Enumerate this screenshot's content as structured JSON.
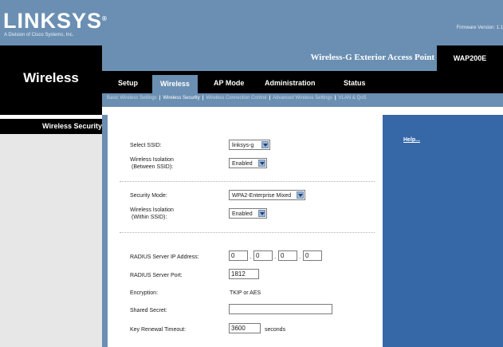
{
  "brand": {
    "logo": "LINKSYS",
    "registered": "®",
    "tagline": "A Division of Cisco Systems, Inc.",
    "firmware": "Firmware Version: 1.1"
  },
  "header": {
    "section_title": "Wireless",
    "product_name": "Wireless-G Exterior Access Point",
    "model": "WAP200E"
  },
  "tabs": [
    {
      "label": "Setup"
    },
    {
      "label": "Wireless"
    },
    {
      "label": "AP Mode"
    },
    {
      "label": "Administration"
    },
    {
      "label": "Status"
    }
  ],
  "subtabs": [
    {
      "label": "Basic Wireless Settings"
    },
    {
      "label": "Wireless Security"
    },
    {
      "label": "Wireless Connection Control"
    },
    {
      "label": "Advanced Wireless Settings"
    },
    {
      "label": "VLAN & QoS"
    }
  ],
  "left_menu": {
    "title": "Wireless Security"
  },
  "help": {
    "label": "Help..."
  },
  "form": {
    "select_ssid": {
      "label": "Select SSID:",
      "value": "linksys-g"
    },
    "isolation_between": {
      "label_line1": "Wireless Isolation",
      "label_line2": "(Between SSID):",
      "value": "Enabled"
    },
    "security_mode": {
      "label": "Security Mode:",
      "value": "WPA2-Enterprise Mixed"
    },
    "isolation_within": {
      "label_line1": "Wireless Isolation",
      "label_line2": "(Within SSID):",
      "value": "Enabled"
    },
    "radius_ip": {
      "label": "RADIUS Server IP Address:",
      "octets": [
        "0",
        "0",
        "0",
        "0"
      ]
    },
    "radius_port": {
      "label": "RADIUS Server Port:",
      "value": "1812"
    },
    "encryption": {
      "label": "Encryption:",
      "value": "TKIP or AES"
    },
    "shared_secret": {
      "label": "Shared Secret:",
      "value": ""
    },
    "key_renewal": {
      "label": "Key Renewal Timeout:",
      "value": "3600",
      "unit": "seconds"
    }
  },
  "colors": {
    "brand_blue": "#6a8fb2",
    "panel_blue": "#3668a8",
    "black": "#000000"
  }
}
